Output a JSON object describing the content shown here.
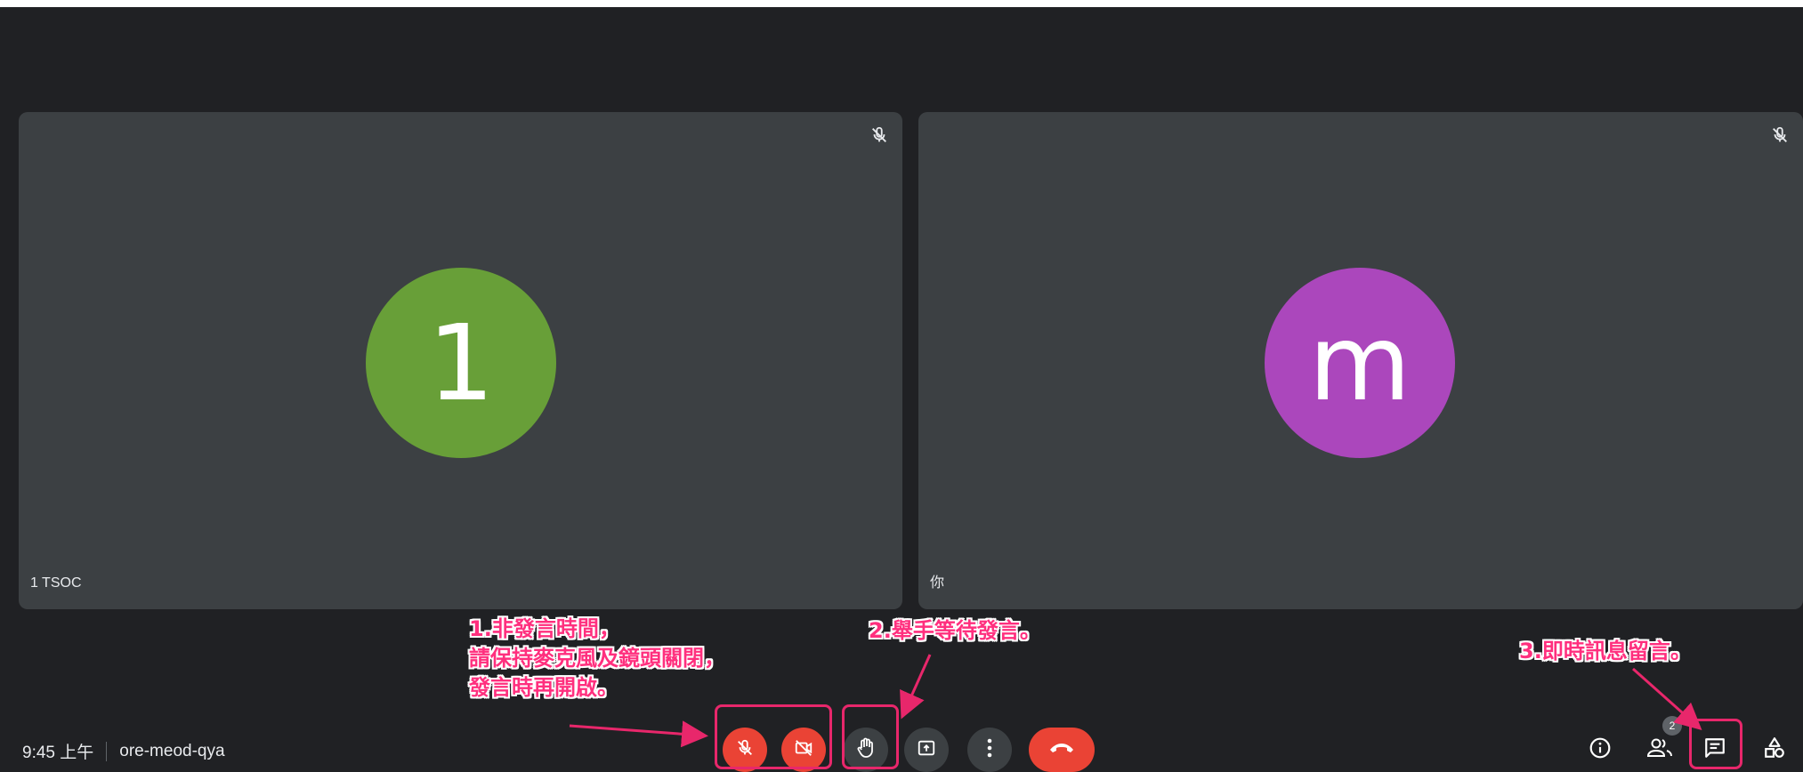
{
  "participants": [
    {
      "initial": "1",
      "name": "1 TSOC",
      "color": "#689f38"
    },
    {
      "initial": "m",
      "name": "你",
      "color": "#ab47bc"
    }
  ],
  "meeting": {
    "time": "9:45 上午",
    "code": "ore-meod-qya"
  },
  "controls": {
    "mic": "mic-off-icon",
    "camera": "videocam-off-icon",
    "raise_hand": "hand-icon",
    "present": "present-screen-icon",
    "more": "more-vert-icon",
    "end_call": "call-end-icon"
  },
  "right_panel": {
    "info": "info-icon",
    "people": "people-icon",
    "people_count": "2",
    "chat": "chat-icon",
    "activities": "activities-icon"
  },
  "annotations": {
    "note1_line1": "1.非發言時間，",
    "note1_line2": "請保持麥克風及鏡頭關閉，",
    "note1_line3": "發言時再開啟。",
    "note2": "2.舉手等待發言。",
    "note3": "3.即時訊息留言。",
    "highlight_color": "#e8276b"
  }
}
